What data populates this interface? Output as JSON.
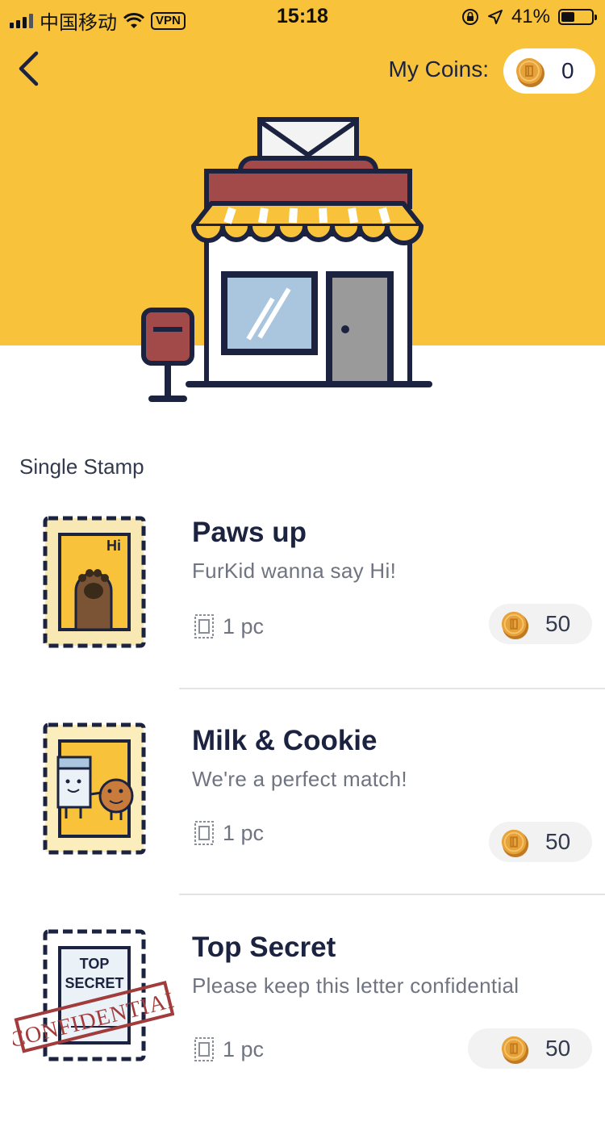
{
  "status_bar": {
    "carrier": "中国移动",
    "vpn": "VPN",
    "time": "15:18",
    "battery": "41%"
  },
  "header": {
    "coins_label": "My Coins:",
    "coins_value": "0"
  },
  "section_title": "Single Stamp",
  "stamps": [
    {
      "name": "Paws up",
      "description": "FurKid wanna say Hi!",
      "quantity": "1 pc",
      "price": "50",
      "art_text": "Hi"
    },
    {
      "name": "Milk & Cookie",
      "description": "We're a perfect match!",
      "quantity": "1 pc",
      "price": "50"
    },
    {
      "name": "Top Secret",
      "description": "Please keep this letter confidential",
      "quantity": "1 pc",
      "price": "50",
      "art_text": [
        "TOP",
        "SECRET",
        "CONFIDENTIAL"
      ]
    }
  ],
  "colors": {
    "hero_yellow": "#f8c23a",
    "navy": "#1b2340",
    "awning_red": "#a24a4a",
    "coin_orange": "#e8a23a"
  }
}
